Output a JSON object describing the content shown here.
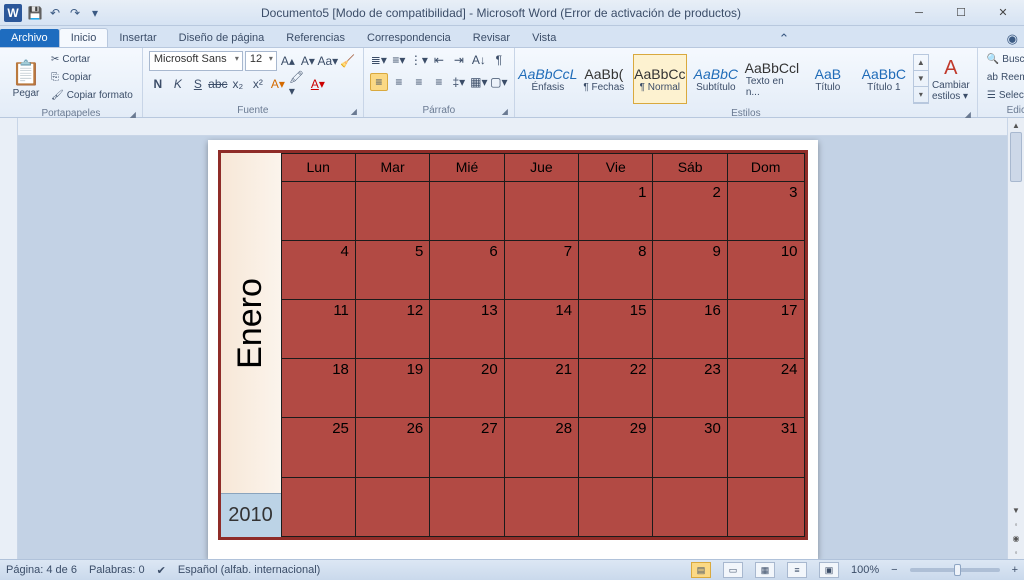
{
  "title": "Documento5 [Modo de compatibilidad] - Microsoft Word (Error de activación de productos)",
  "tabs": {
    "file": "Archivo",
    "items": [
      "Inicio",
      "Insertar",
      "Diseño de página",
      "Referencias",
      "Correspondencia",
      "Revisar",
      "Vista"
    ],
    "active": 0
  },
  "ribbon": {
    "clipboard": {
      "label": "Portapapeles",
      "paste": "Pegar",
      "cut": "Cortar",
      "copy": "Copiar",
      "fmt": "Copiar formato"
    },
    "font": {
      "label": "Fuente",
      "name": "Microsoft Sans",
      "size": "12"
    },
    "para": {
      "label": "Párrafo"
    },
    "styles": {
      "label": "Estilos",
      "items": [
        {
          "prev": "AaBbCcL",
          "name": "Énfasis",
          "blue": true,
          "i": true
        },
        {
          "prev": "AaBb(",
          "name": "¶ Fechas"
        },
        {
          "prev": "AaBbCc",
          "name": "¶ Normal",
          "sel": true
        },
        {
          "prev": "AaBbC",
          "name": "Subtítulo",
          "blue": true,
          "i": true
        },
        {
          "prev": "AaBbCcl",
          "name": "Texto en n..."
        },
        {
          "prev": "AaB",
          "name": "Título",
          "blue": true
        },
        {
          "prev": "AaBbC",
          "name": "Título 1",
          "blue": true
        }
      ],
      "change": "Cambiar estilos"
    },
    "edit": {
      "label": "Edición",
      "find": "Buscar",
      "replace": "Reemplazar",
      "select": "Seleccionar"
    }
  },
  "calendar": {
    "month": "Enero",
    "year": "2010",
    "days": [
      "Lun",
      "Mar",
      "Mié",
      "Jue",
      "Vie",
      "Sáb",
      "Dom"
    ],
    "weeks": [
      [
        "",
        "",
        "",
        "",
        "1",
        "2",
        "3"
      ],
      [
        "4",
        "5",
        "6",
        "7",
        "8",
        "9",
        "10"
      ],
      [
        "11",
        "12",
        "13",
        "14",
        "15",
        "16",
        "17"
      ],
      [
        "18",
        "19",
        "20",
        "21",
        "22",
        "23",
        "24"
      ],
      [
        "25",
        "26",
        "27",
        "28",
        "29",
        "30",
        "31"
      ],
      [
        "",
        "",
        "",
        "",
        "",
        "",
        ""
      ]
    ]
  },
  "status": {
    "page": "Página: 4 de 6",
    "words": "Palabras: 0",
    "lang": "Español (alfab. internacional)",
    "zoom": "100%"
  }
}
